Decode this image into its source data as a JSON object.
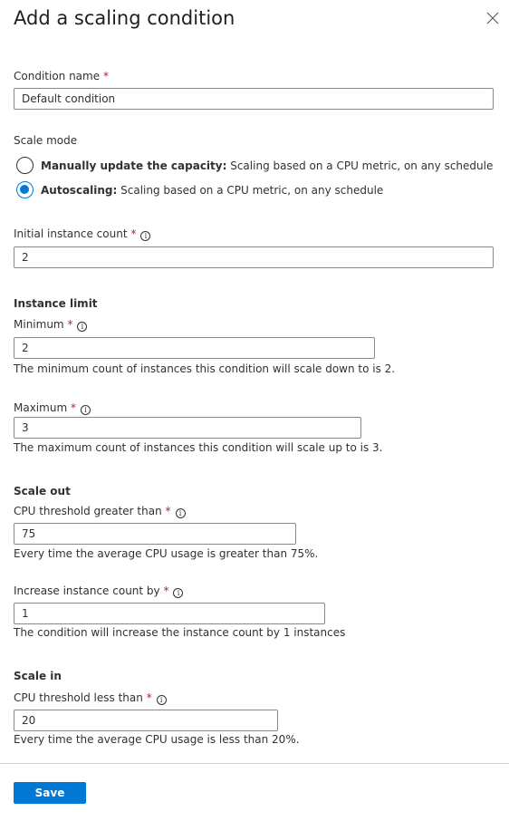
{
  "title": "Add a scaling condition",
  "required_mark": "*",
  "info_glyph": "i",
  "condition_name": {
    "label": "Condition name",
    "value": "Default condition"
  },
  "scale_mode": {
    "label": "Scale mode",
    "options": [
      {
        "bold": "Manually update the capacity:",
        "text": " Scaling based on a CPU metric, on any schedule",
        "selected": false
      },
      {
        "bold": "Autoscaling:",
        "text": " Scaling based on a CPU metric, on any schedule",
        "selected": true
      }
    ]
  },
  "initial_count": {
    "label": "Initial instance count",
    "value": "2"
  },
  "instance_limit": {
    "heading": "Instance limit",
    "minimum": {
      "label": "Minimum",
      "value": "2",
      "help": "The minimum count of instances this condition will scale down to is 2."
    },
    "maximum": {
      "label": "Maximum",
      "value": "3",
      "help": "The maximum count of instances this condition will scale up to is 3."
    }
  },
  "scale_out": {
    "heading": "Scale out",
    "cpu": {
      "label": "CPU threshold greater than",
      "value": "75",
      "help": "Every time the average CPU usage is greater than 75%."
    },
    "increase": {
      "label": "Increase instance count by",
      "value": "1",
      "help": "The condition will increase the instance count by 1 instances"
    }
  },
  "scale_in": {
    "heading": "Scale in",
    "cpu": {
      "label": "CPU threshold less than",
      "value": "20",
      "help": "Every time the average CPU usage is less than 20%."
    }
  },
  "save_label": "Save",
  "colors": {
    "accent": "#0078d4",
    "required": "#a4262c"
  }
}
